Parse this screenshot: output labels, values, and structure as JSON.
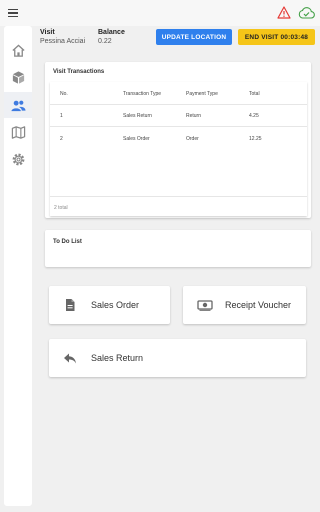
{
  "header": {
    "menu_icon": "hamburger-icon",
    "alert_icon": "warning-triangle-icon",
    "sync_icon": "cloud-check-icon",
    "alert_color": "#e53935",
    "sync_color": "#43a047"
  },
  "sidebar": {
    "items": [
      {
        "name": "home",
        "icon": "home-icon"
      },
      {
        "name": "products",
        "icon": "cube-icon"
      },
      {
        "name": "customers",
        "icon": "people-icon",
        "active": true
      },
      {
        "name": "map",
        "icon": "map-icon"
      },
      {
        "name": "settings",
        "icon": "gear-icon"
      }
    ]
  },
  "visit": {
    "visit_label": "Visit",
    "customer": "Pessina Acciai",
    "balance_label": "Balance",
    "balance": "0.22",
    "update_location": "UPDATE LOCATION",
    "end_visit": "END VISIT 00:03:48"
  },
  "transactions": {
    "title": "Visit Transactions",
    "columns": [
      "No.",
      "Transaction Type",
      "Payment Type",
      "Total"
    ],
    "rows": [
      [
        "1",
        "Sales Return",
        "Return",
        "4.25"
      ],
      [
        "2",
        "Sales Order",
        "Order",
        "12.25"
      ]
    ],
    "footer": "2 total"
  },
  "todo": {
    "title": "To Do List"
  },
  "actions": {
    "sales_order": "Sales Order",
    "receipt_voucher": "Receipt Voucher",
    "sales_return": "Sales Return"
  },
  "colors": {
    "primary": "#2f80ed",
    "warning": "#f5c518",
    "sidebar_active": "#3f7be0",
    "icon_grey": "#888888"
  }
}
